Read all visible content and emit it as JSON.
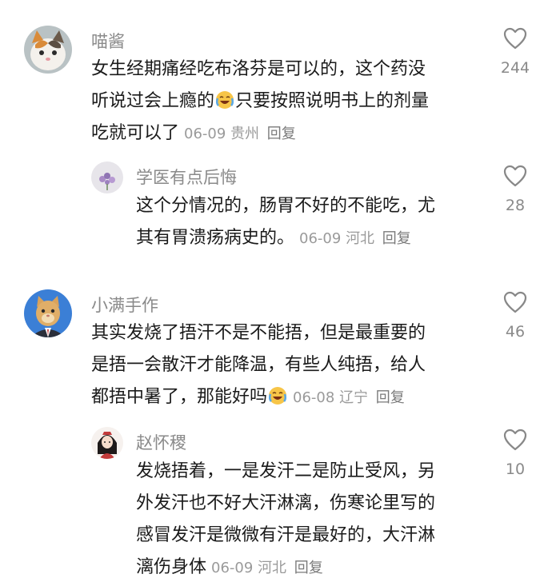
{
  "comments": [
    {
      "user": "喵酱",
      "lines": [
        "女生经期痛经吃布洛芬是可以的，这个药没",
        "听说过会上瘾的",
        "只要按照说明书上的剂量",
        "吃就可以了"
      ],
      "date": "06-09",
      "location": "贵州",
      "reply_label": "回复",
      "likes": "244",
      "avatar_icon": "cat-face-avatar"
    },
    {
      "user": "学医有点后悔",
      "lines": [
        "这个分情况的，肠胃不好的不能吃，尤",
        "其有胃溃疡病史的。"
      ],
      "date": "06-09",
      "location": "河北",
      "reply_label": "回复",
      "likes": "28",
      "avatar_icon": "flower-avatar"
    },
    {
      "user": "小满手作",
      "lines": [
        "其实发烧了捂汗不是不能捂，但是最重要的",
        "是捂一会散汗才能降温，有些人纯捂，给人",
        "都捂中暑了，那能好吗"
      ],
      "date": "06-08",
      "location": "辽宁",
      "reply_label": "回复",
      "likes": "46",
      "avatar_icon": "cat-in-suit-avatar"
    },
    {
      "user": "赵怀稷",
      "lines": [
        "发烧捂着，一是发汗二是防止受风，另",
        "外发汗也不好大汗淋漓，伤寒论里写的",
        "感冒发汗是微微有汗是最好的，大汗淋",
        "漓伤身体"
      ],
      "date": "06-09",
      "location": "河北",
      "reply_label": "回复",
      "likes": "10",
      "avatar_icon": "costume-girl-avatar"
    }
  ],
  "colors": {
    "username": "#8a8a8a",
    "body_text": "#1a1a1a",
    "meta": "#9a9a9a",
    "heart_outline": "#888888"
  },
  "icons": {
    "like": "heart-outline-icon",
    "emoji": "laugh-cry-emoji-icon"
  }
}
